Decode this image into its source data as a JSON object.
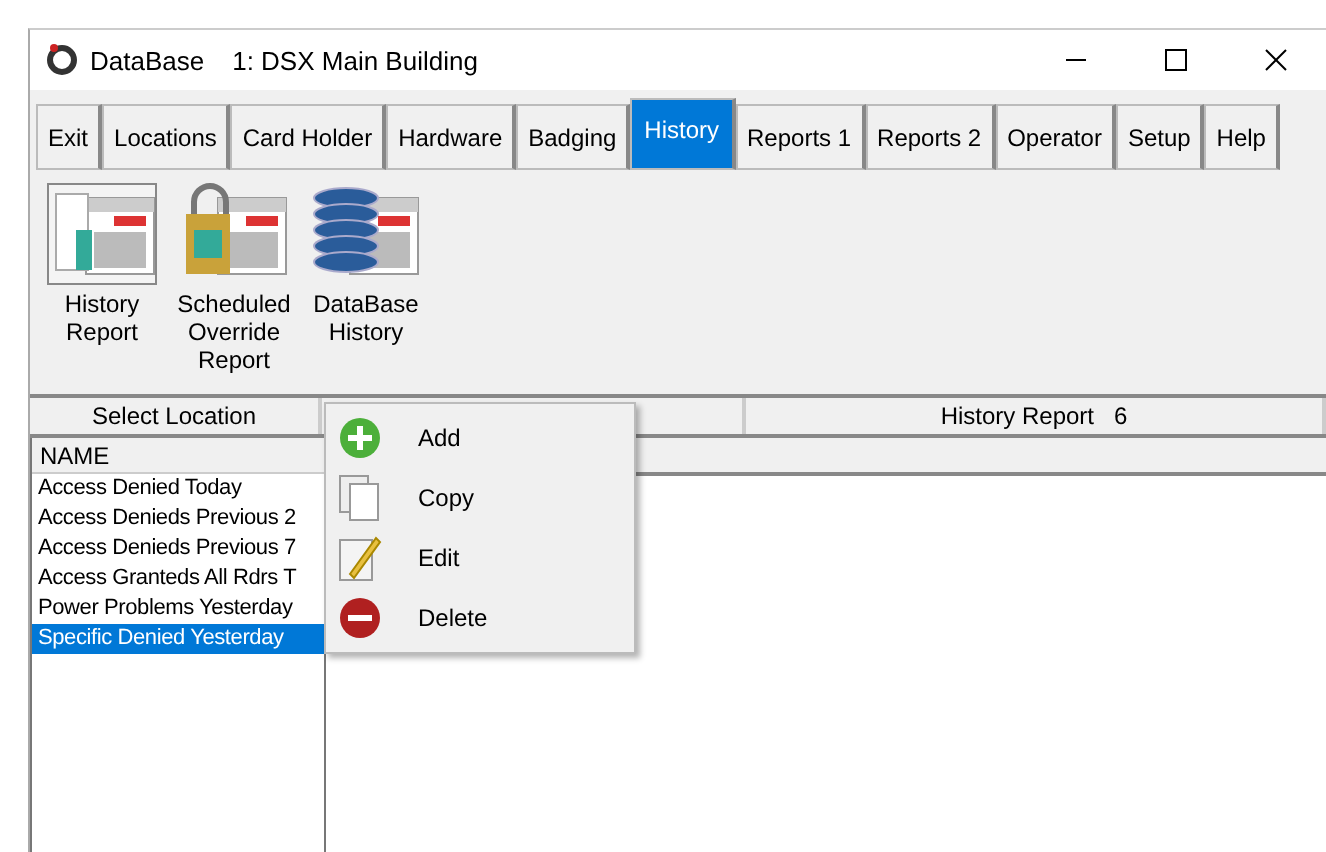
{
  "window": {
    "title": "DataBase",
    "subtitle": "1: DSX Main Building"
  },
  "tabs": [
    {
      "label": "Exit",
      "selected": false
    },
    {
      "label": "Locations",
      "selected": false
    },
    {
      "label": "Card Holder",
      "selected": false
    },
    {
      "label": "Hardware",
      "selected": false
    },
    {
      "label": "Badging",
      "selected": false
    },
    {
      "label": "History",
      "selected": true
    },
    {
      "label": "Reports 1",
      "selected": false
    },
    {
      "label": "Reports 2",
      "selected": false
    },
    {
      "label": "Operator",
      "selected": false
    },
    {
      "label": "Setup",
      "selected": false
    },
    {
      "label": "Help",
      "selected": false
    }
  ],
  "toolbar": [
    {
      "label": "History Report",
      "kind": "report"
    },
    {
      "label": "Scheduled Override Report",
      "kind": "lock"
    },
    {
      "label": "DataBase History",
      "kind": "database"
    }
  ],
  "header": {
    "left": "Select Location",
    "right": "History Report   6"
  },
  "list": {
    "column": "NAME",
    "rows": [
      {
        "text": "Access Denied Today",
        "selected": false
      },
      {
        "text": "Access Denieds Previous 2",
        "selected": false
      },
      {
        "text": "Access Denieds Previous 7",
        "selected": false
      },
      {
        "text": "Access Granteds All Rdrs T",
        "selected": false
      },
      {
        "text": "Power Problems Yesterday",
        "selected": false
      },
      {
        "text": "Specific Denied Yesterday",
        "selected": true
      }
    ]
  },
  "context_menu": [
    {
      "label": "Add",
      "kind": "add"
    },
    {
      "label": "Copy",
      "kind": "copy"
    },
    {
      "label": "Edit",
      "kind": "edit"
    },
    {
      "label": "Delete",
      "kind": "delete"
    }
  ]
}
